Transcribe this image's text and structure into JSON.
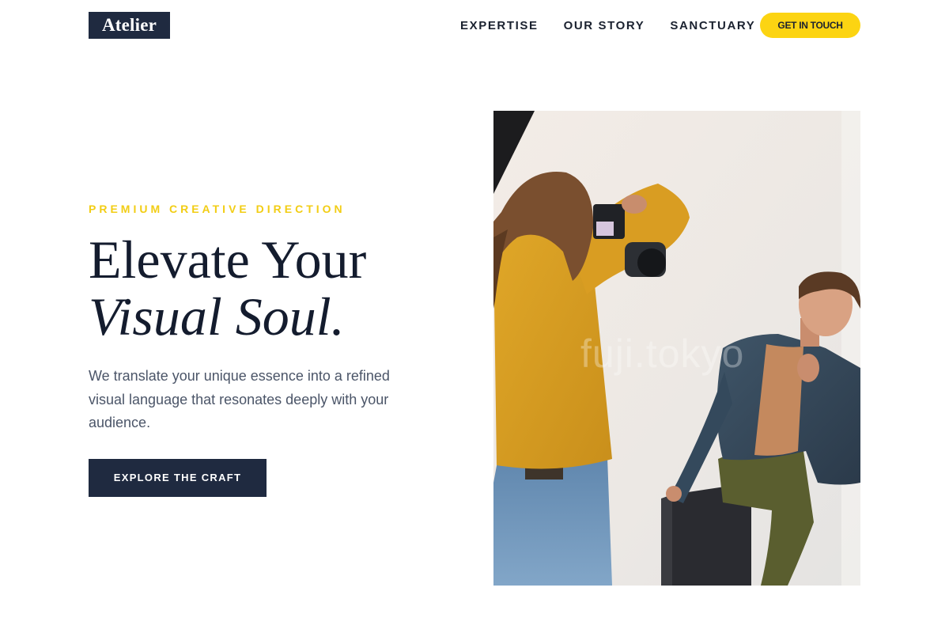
{
  "header": {
    "logo": "Atelier",
    "nav": [
      {
        "label": "EXPERTISE"
      },
      {
        "label": "OUR STORY"
      },
      {
        "label": "SANCTUARY"
      }
    ],
    "cta_label": "GET IN TOUCH"
  },
  "hero": {
    "eyebrow": "PREMIUM CREATIVE DIRECTION",
    "headline_line1": "Elevate Your",
    "headline_line2": "Visual Soul.",
    "lede": "We translate your unique essence into a refined visual language that resonates deeply with your audience.",
    "button_label": "EXPLORE THE CRAFT",
    "image": {
      "watermark": "fuji.tokyo",
      "subject": "photographer-shooting-model-photo"
    }
  },
  "colors": {
    "accent": "#fcd412",
    "eyebrow": "#f2cd14",
    "navy": "#1f2a40",
    "heading": "#141c2e",
    "body_text": "#4b5568"
  }
}
